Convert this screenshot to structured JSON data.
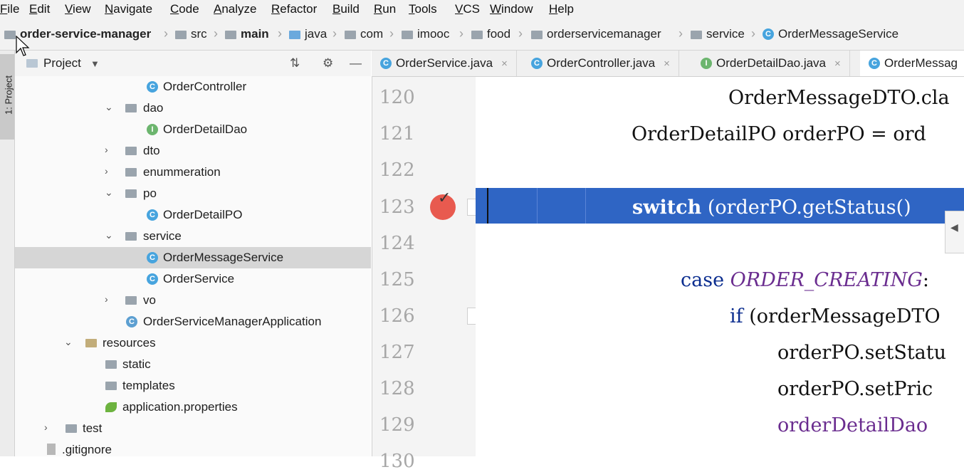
{
  "menu": [
    "File",
    "Edit",
    "View",
    "Navigate",
    "Code",
    "Analyze",
    "Refactor",
    "Build",
    "Run",
    "Tools",
    "VCS",
    "Window",
    "Help"
  ],
  "breadcrumb": [
    "order-service-manager",
    "src",
    "main",
    "java",
    "com",
    "imooc",
    "food",
    "orderservicemanager",
    "service",
    "OrderMessageService"
  ],
  "side_tab": "1: Project",
  "project_panel": {
    "title": "Project"
  },
  "tree": [
    {
      "label": "OrderController",
      "icon": "class-icon",
      "expanded": null
    },
    {
      "label": "dao",
      "icon": "folder-icon",
      "expanded": true
    },
    {
      "label": "OrderDetailDao",
      "icon": "interface-icon",
      "expanded": null
    },
    {
      "label": "dto",
      "icon": "folder-icon",
      "expanded": false
    },
    {
      "label": "enummeration",
      "icon": "folder-icon",
      "expanded": false
    },
    {
      "label": "po",
      "icon": "folder-icon",
      "expanded": true
    },
    {
      "label": "OrderDetailPO",
      "icon": "class-icon",
      "expanded": null
    },
    {
      "label": "service",
      "icon": "folder-icon",
      "expanded": true
    },
    {
      "label": "OrderMessageService",
      "icon": "class-icon",
      "expanded": null,
      "selected": true
    },
    {
      "label": "OrderService",
      "icon": "class-icon",
      "expanded": null
    },
    {
      "label": "vo",
      "icon": "folder-icon",
      "expanded": false
    },
    {
      "label": "OrderServiceManagerApplication",
      "icon": "spring-class-icon",
      "expanded": null
    },
    {
      "label": "resources",
      "icon": "resources-folder-icon",
      "expanded": true
    },
    {
      "label": "static",
      "icon": "folder-icon",
      "expanded": null
    },
    {
      "label": "templates",
      "icon": "folder-icon",
      "expanded": null
    },
    {
      "label": "application.properties",
      "icon": "spring-leaf-icon",
      "expanded": null
    },
    {
      "label": "test",
      "icon": "folder-icon",
      "expanded": false
    },
    {
      "label": ".gitignore",
      "icon": "file-icon",
      "expanded": null
    }
  ],
  "tabs": [
    {
      "label": "OrderService.java"
    },
    {
      "label": "OrderController.java"
    },
    {
      "label": "OrderDetailDao.java"
    },
    {
      "label": "OrderMessag",
      "active": true
    }
  ],
  "code": [
    {
      "n": "120",
      "text": "OrderMessageDTO.cla",
      "indent": 355
    },
    {
      "n": "121",
      "text": "OrderDetailPO orderPO = ord",
      "indent": 219
    },
    {
      "n": "122",
      "text": "",
      "indent": 0
    },
    {
      "n": "123",
      "text": "switch (orderPO.getStatus()",
      "indent": 220
    },
    {
      "n": "124",
      "text": "",
      "indent": 0
    },
    {
      "n": "125",
      "text": "case ORDER_CREATING:",
      "indent": 288
    },
    {
      "n": "126",
      "text": "if (orderMessageDTO",
      "indent": 357
    },
    {
      "n": "127",
      "text": "orderPO.setStatu",
      "indent": 424
    },
    {
      "n": "128",
      "text": "orderPO.setPric",
      "indent": 424
    },
    {
      "n": "129",
      "text": "orderDetailDao",
      "indent": 424
    },
    {
      "n": "130",
      "text": "",
      "indent": 0
    }
  ],
  "colors": {
    "highlight": "#2f65c4",
    "keyword": "#0b2d8f",
    "enum": "#6a2c8f",
    "field": "#6a2c8f",
    "breakpoint": "#e85a4f"
  }
}
